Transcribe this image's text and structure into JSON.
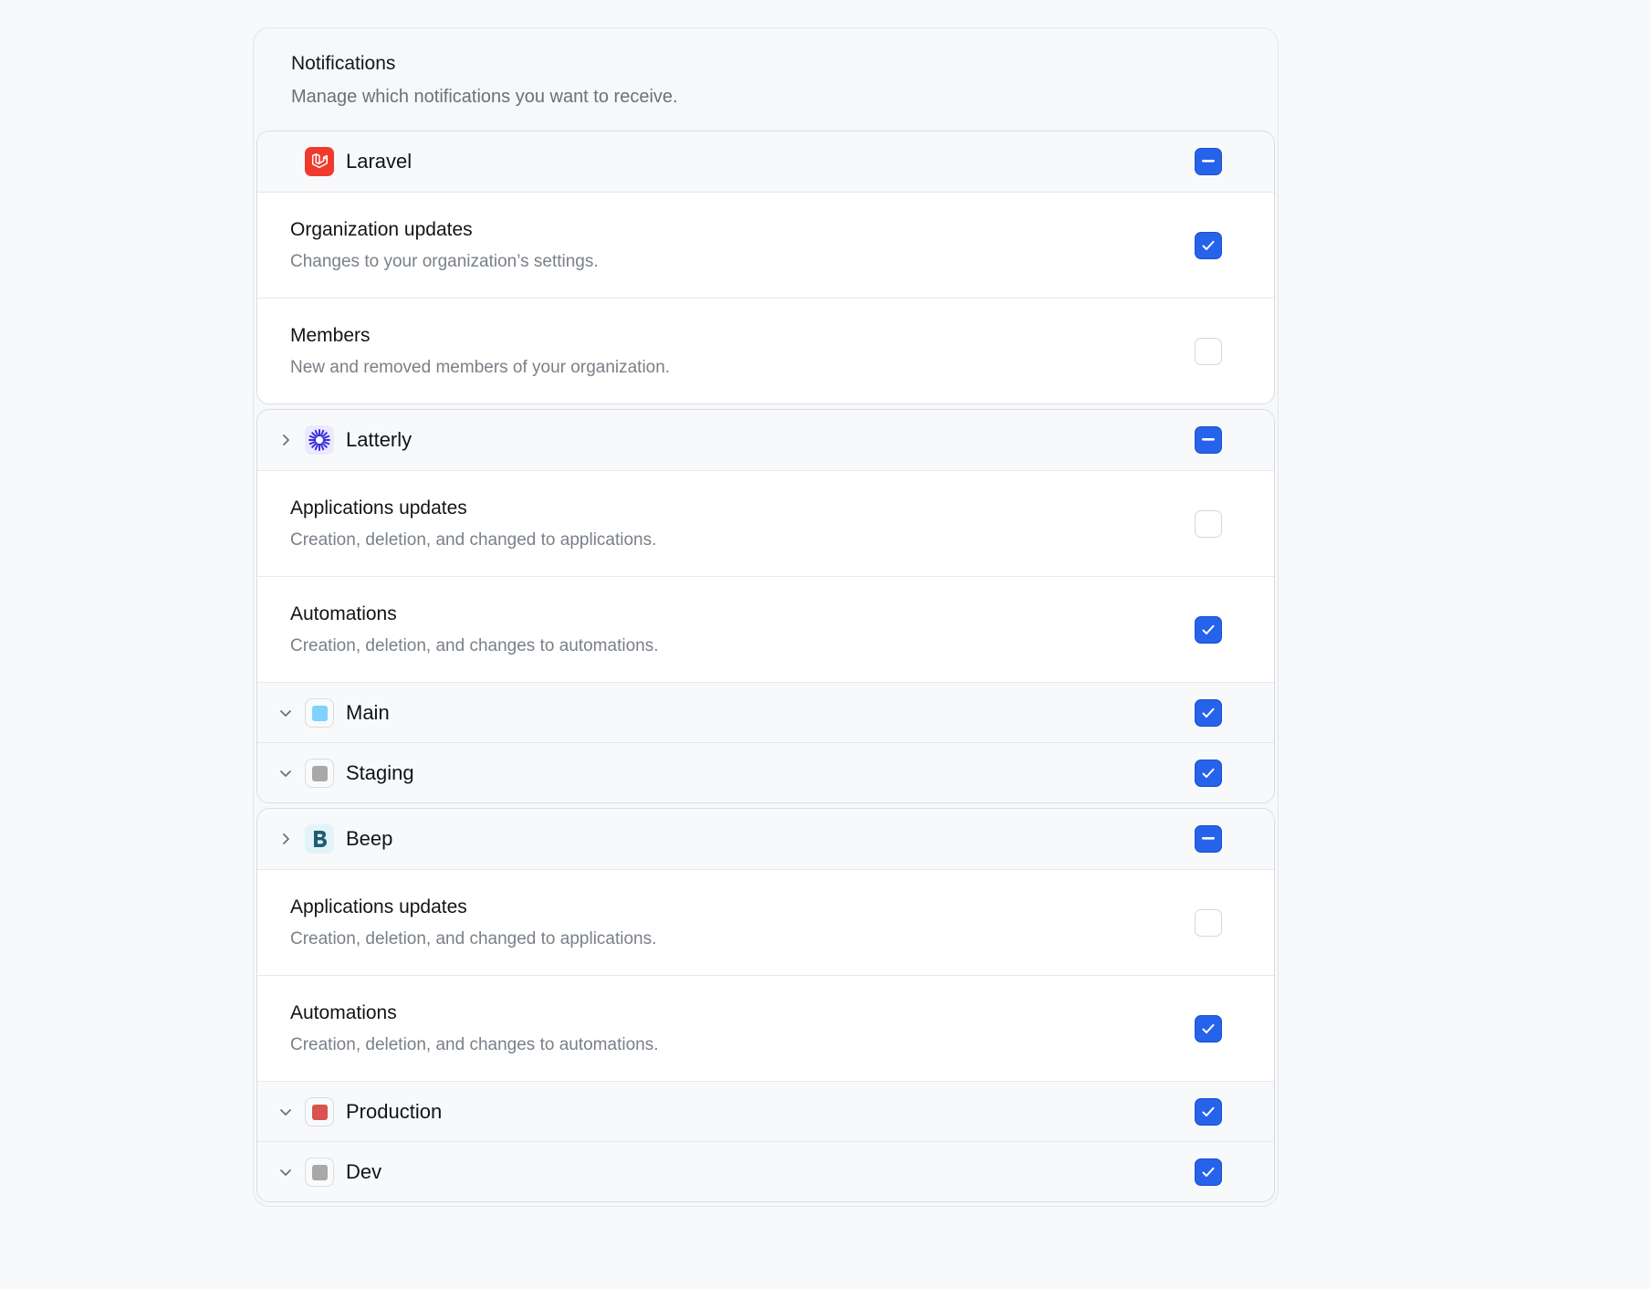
{
  "header": {
    "title": "Notifications",
    "subtitle": "Manage which notifications you want to receive."
  },
  "groups": [
    {
      "name": "Laravel",
      "logo_icon": "laravel-icon",
      "logo_color": "#ef3b2d",
      "expander": null,
      "state": "indeterminate",
      "items": [
        {
          "title": "Organization updates",
          "description": "Changes to your organization’s settings.",
          "checked": true
        },
        {
          "title": "Members",
          "description": "New and removed members of your organization.",
          "checked": false
        }
      ],
      "environments": []
    },
    {
      "name": "Latterly",
      "logo_icon": "latterly-icon",
      "logo_color": "#3b2de0",
      "expander": "collapsed",
      "state": "indeterminate",
      "items": [
        {
          "title": "Applications updates",
          "description": "Creation, deletion, and changed to applications.",
          "checked": false
        },
        {
          "title": "Automations",
          "description": "Creation, deletion, and changes to automations.",
          "checked": true
        }
      ],
      "environments": [
        {
          "name": "Main",
          "color": "#7dd3fc",
          "checked": true
        },
        {
          "name": "Staging",
          "color": "#a8a8a8",
          "checked": true
        }
      ]
    },
    {
      "name": "Beep",
      "logo_icon": "beep-icon",
      "logo_color": "#1f5c73",
      "expander": "collapsed",
      "state": "indeterminate",
      "items": [
        {
          "title": "Applications updates",
          "description": "Creation, deletion, and changed to applications.",
          "checked": false
        },
        {
          "title": "Automations",
          "description": "Creation, deletion, and changes to automations.",
          "checked": true
        }
      ],
      "environments": [
        {
          "name": "Production",
          "color": "#d9534f",
          "checked": true
        },
        {
          "name": "Dev",
          "color": "#a8a8a8",
          "checked": true
        }
      ]
    }
  ],
  "colors": {
    "accent": "#2563eb",
    "text": "#111418",
    "muted": "#7a8088",
    "border": "#d9dce1"
  }
}
